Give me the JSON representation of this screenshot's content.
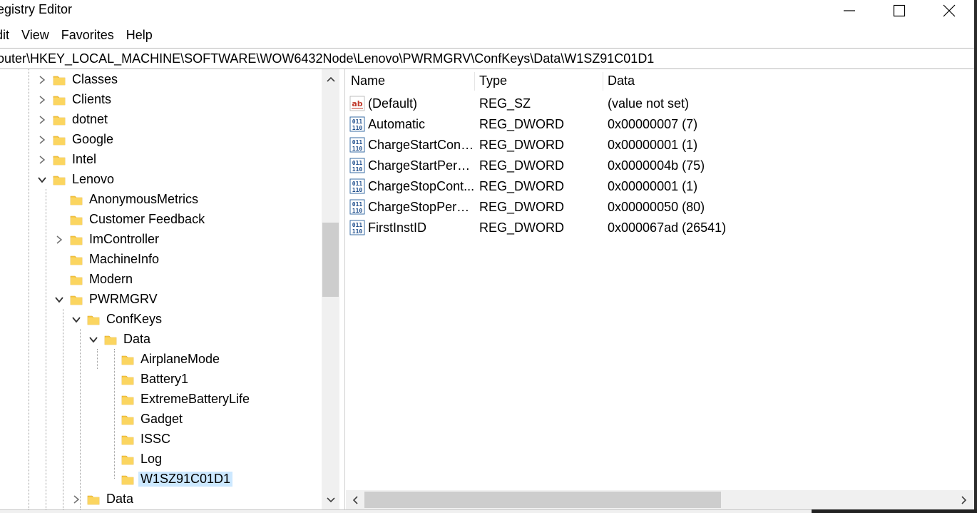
{
  "window": {
    "title": "egistry Editor"
  },
  "menu": [
    "Edit",
    "View",
    "Favorites",
    "Help"
  ],
  "menu_visible": [
    "dit",
    "View",
    "Favorites",
    "Help"
  ],
  "address": "outer\\HKEY_LOCAL_MACHINE\\SOFTWARE\\WOW6432Node\\Lenovo\\PWRMGRV\\ConfKeys\\Data\\W1SZ91C01D1",
  "tree": [
    {
      "label": "Classes",
      "level": 0,
      "expander": "collapsed"
    },
    {
      "label": "Clients",
      "level": 0,
      "expander": "collapsed"
    },
    {
      "label": "dotnet",
      "level": 0,
      "expander": "collapsed"
    },
    {
      "label": "Google",
      "level": 0,
      "expander": "collapsed"
    },
    {
      "label": "Intel",
      "level": 0,
      "expander": "collapsed"
    },
    {
      "label": "Lenovo",
      "level": 0,
      "expander": "expanded"
    },
    {
      "label": "AnonymousMetrics",
      "level": 1,
      "expander": "none"
    },
    {
      "label": "Customer Feedback",
      "level": 1,
      "expander": "none"
    },
    {
      "label": "ImController",
      "level": 1,
      "expander": "collapsed"
    },
    {
      "label": "MachineInfo",
      "level": 1,
      "expander": "none"
    },
    {
      "label": "Modern",
      "level": 1,
      "expander": "none"
    },
    {
      "label": "PWRMGRV",
      "level": 1,
      "expander": "expanded"
    },
    {
      "label": "ConfKeys",
      "level": 2,
      "expander": "expanded"
    },
    {
      "label": "Data",
      "level": 3,
      "expander": "expanded"
    },
    {
      "label": "AirplaneMode",
      "level": 4,
      "expander": "none"
    },
    {
      "label": "Battery1",
      "level": 4,
      "expander": "none"
    },
    {
      "label": "ExtremeBatteryLife",
      "level": 4,
      "expander": "none"
    },
    {
      "label": "Gadget",
      "level": 4,
      "expander": "none"
    },
    {
      "label": "ISSC",
      "level": 4,
      "expander": "none"
    },
    {
      "label": "Log",
      "level": 4,
      "expander": "none"
    },
    {
      "label": "W1SZ91C01D1",
      "level": 4,
      "expander": "none",
      "selected": true
    },
    {
      "label": "Data",
      "level": 2,
      "expander": "collapsed"
    }
  ],
  "columns": {
    "name": "Name",
    "type": "Type",
    "data": "Data"
  },
  "values": [
    {
      "icon": "string-value-icon",
      "name": "(Default)",
      "type": "REG_SZ",
      "data": "(value not set)"
    },
    {
      "icon": "binary-value-icon",
      "name": "Automatic",
      "type": "REG_DWORD",
      "data": "0x00000007 (7)"
    },
    {
      "icon": "binary-value-icon",
      "name": "ChargeStartContr...",
      "type": "REG_DWORD",
      "data": "0x00000001 (1)"
    },
    {
      "icon": "binary-value-icon",
      "name": "ChargeStartPerce...",
      "type": "REG_DWORD",
      "data": "0x0000004b (75)"
    },
    {
      "icon": "binary-value-icon",
      "name": "ChargeStopCont...",
      "type": "REG_DWORD",
      "data": "0x00000001 (1)"
    },
    {
      "icon": "binary-value-icon",
      "name": "ChargeStopPerce...",
      "type": "REG_DWORD",
      "data": "0x00000050 (80)"
    },
    {
      "icon": "binary-value-icon",
      "name": "FirstInstID",
      "type": "REG_DWORD",
      "data": "0x000067ad (26541)"
    }
  ],
  "colors": {
    "selection": "#cce8ff",
    "folder": "#f7c948",
    "scrollbar": "#f0f0f0",
    "scroll_thumb": "#cdcdcd"
  }
}
